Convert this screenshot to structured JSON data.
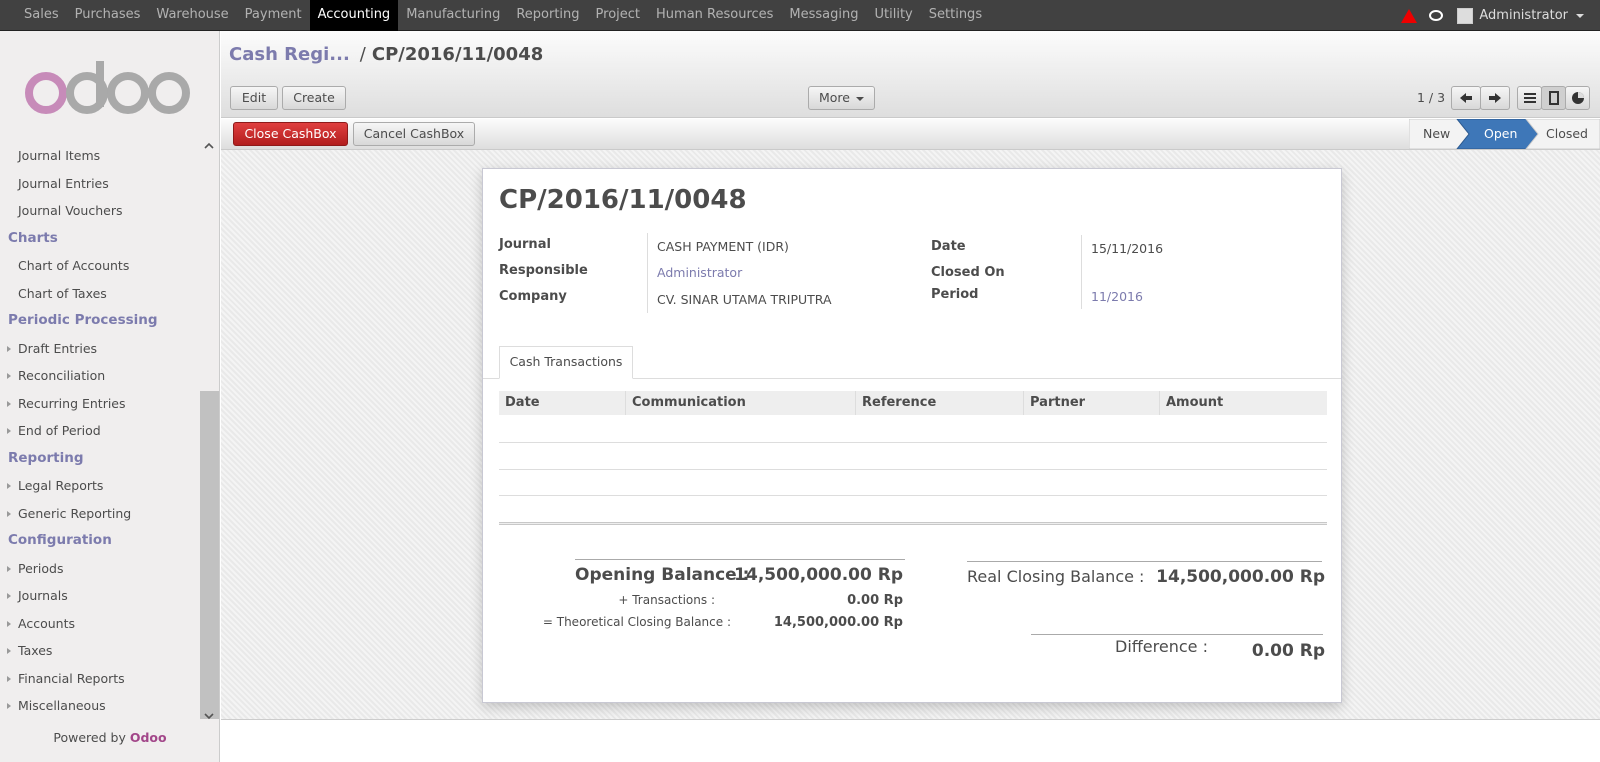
{
  "topbar": {
    "menu": [
      "Sales",
      "Purchases",
      "Warehouse",
      "Payment",
      "Accounting",
      "Manufacturing",
      "Reporting",
      "Project",
      "Human Resources",
      "Messaging",
      "Utility",
      "Settings"
    ],
    "active": "Accounting",
    "user": "Administrator"
  },
  "sidebar": {
    "logo": "odoo",
    "items": [
      {
        "kind": "link",
        "label": "Journal Items"
      },
      {
        "kind": "link",
        "label": "Journal Entries"
      },
      {
        "kind": "link",
        "label": "Journal Vouchers"
      },
      {
        "kind": "section",
        "label": "Charts"
      },
      {
        "kind": "link",
        "label": "Chart of Accounts"
      },
      {
        "kind": "link",
        "label": "Chart of Taxes"
      },
      {
        "kind": "section",
        "label": "Periodic Processing"
      },
      {
        "kind": "exp",
        "label": "Draft Entries"
      },
      {
        "kind": "exp",
        "label": "Reconciliation"
      },
      {
        "kind": "exp",
        "label": "Recurring Entries"
      },
      {
        "kind": "exp",
        "label": "End of Period"
      },
      {
        "kind": "section",
        "label": "Reporting"
      },
      {
        "kind": "exp",
        "label": "Legal Reports"
      },
      {
        "kind": "exp",
        "label": "Generic Reporting"
      },
      {
        "kind": "section",
        "label": "Configuration"
      },
      {
        "kind": "exp",
        "label": "Periods"
      },
      {
        "kind": "exp",
        "label": "Journals"
      },
      {
        "kind": "exp",
        "label": "Accounts"
      },
      {
        "kind": "exp",
        "label": "Taxes"
      },
      {
        "kind": "exp",
        "label": "Financial Reports"
      },
      {
        "kind": "exp",
        "label": "Miscellaneous"
      }
    ],
    "powered_prefix": "Powered by",
    "powered_brand": "Odoo"
  },
  "breadcrumb": {
    "parent": "Cash Regi...",
    "sep": "/",
    "current": "CP/2016/11/0048"
  },
  "buttons": {
    "edit": "Edit",
    "create": "Create",
    "more": "More",
    "close_cashbox": "Close CashBox",
    "cancel_cashbox": "Cancel CashBox"
  },
  "pager": "1 / 3",
  "statuses": [
    "New",
    "Open",
    "Closed"
  ],
  "active_status": "Open",
  "record": {
    "title": "CP/2016/11/0048",
    "journal_label": "Journal",
    "journal": "CASH PAYMENT (IDR)",
    "responsible_label": "Responsible",
    "responsible": "Administrator",
    "company_label": "Company",
    "company": "CV. SINAR UTAMA TRIPUTRA",
    "date_label": "Date",
    "date": "15/11/2016",
    "closed_on_label": "Closed On",
    "period_label": "Period",
    "period": "11/2016"
  },
  "tab": "Cash Transactions",
  "table": {
    "columns": [
      "Date",
      "Communication",
      "Reference",
      "Partner",
      "Amount"
    ]
  },
  "balances": {
    "opening_label": "Opening Balance :",
    "opening": "14,500,000.00 Rp",
    "transactions_label": "+ Transactions :",
    "transactions": "0.00 Rp",
    "theoretical_label": "= Theoretical Closing Balance :",
    "theoretical": "14,500,000.00 Rp",
    "real_label": "Real Closing Balance :",
    "real": "14,500,000.00 Rp",
    "difference_label": "Difference :",
    "difference": "0.00 Rp"
  }
}
